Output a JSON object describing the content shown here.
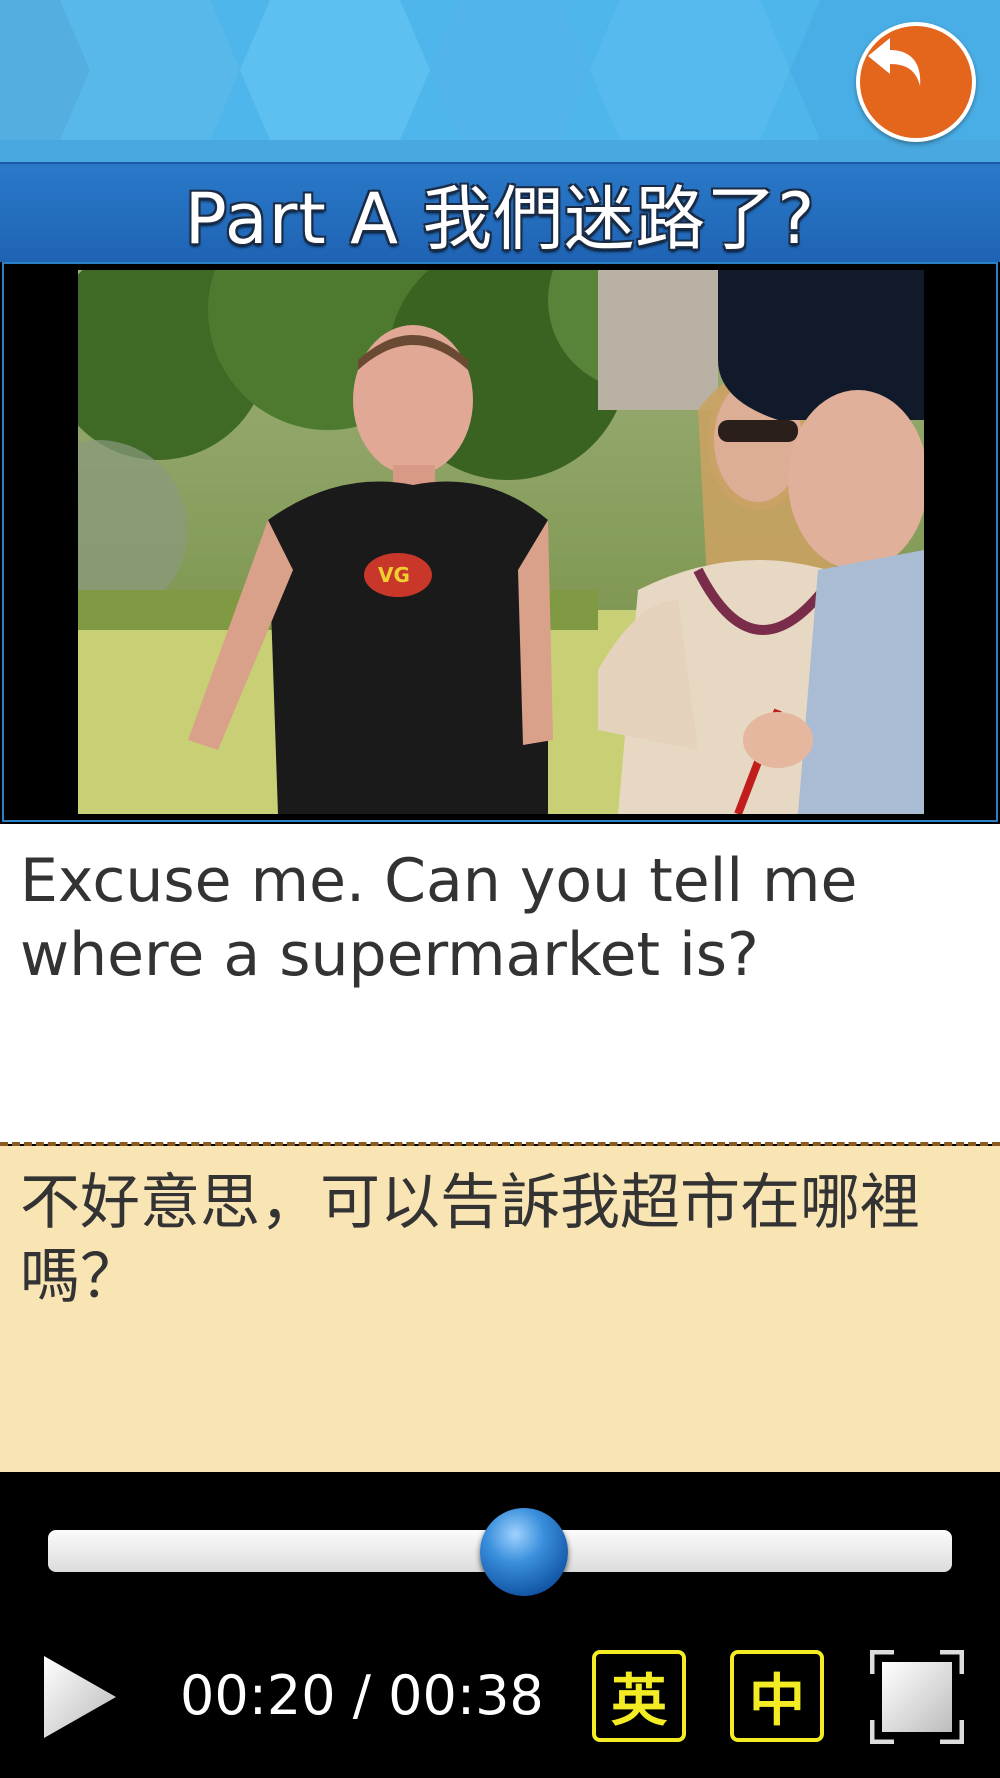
{
  "header": {
    "title": "Part A 我們迷路了?"
  },
  "video": {
    "description_icon": "video-frame"
  },
  "subtitles": {
    "english": "Excuse me. Can you tell me where a supermarket is?",
    "chinese": "不好意思，可以告訴我超市在哪裡嗎？"
  },
  "player": {
    "progress": 0.526,
    "current_time": "00:20",
    "separator": "/",
    "total_time": "00:38",
    "english_button": "英",
    "chinese_button": "中"
  },
  "colors": {
    "header_bg": "#4fb6ec",
    "title_bar": "#2a79c9",
    "back_button": "#e4661d",
    "chinese_panel": "#f9e5b4",
    "lang_button": "#f3ec24"
  }
}
